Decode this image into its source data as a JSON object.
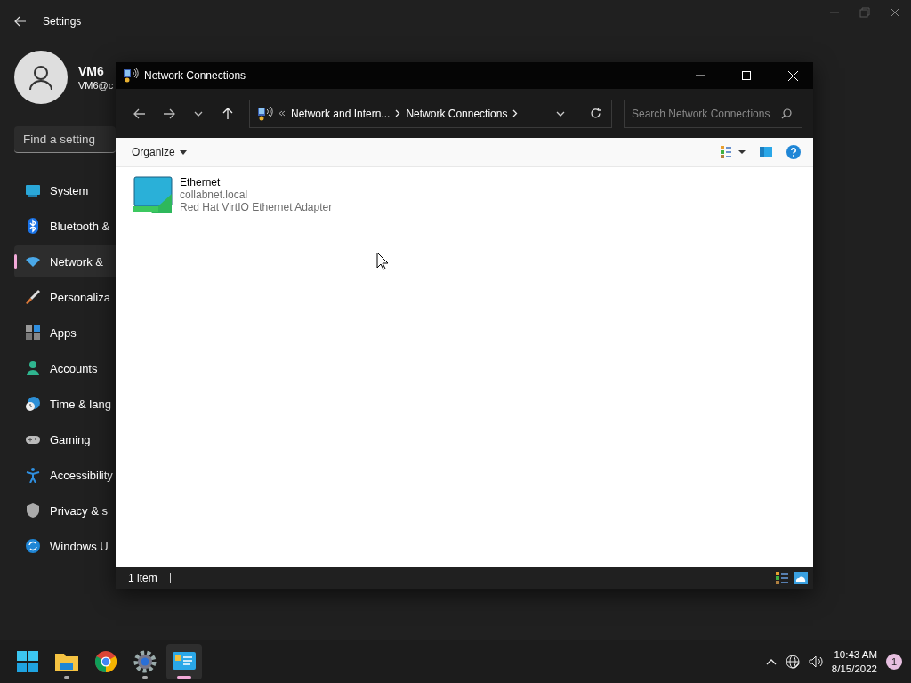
{
  "settings": {
    "title": "Settings",
    "user": {
      "name": "VM6",
      "email": "VM6@c"
    },
    "search": {
      "placeholder": "Find a setting"
    },
    "nav": [
      {
        "kind": "system",
        "label": "System",
        "selected": false
      },
      {
        "kind": "bluetooth",
        "label": "Bluetooth &",
        "selected": false
      },
      {
        "kind": "network",
        "label": "Network &",
        "selected": true
      },
      {
        "kind": "personalization",
        "label": "Personaliza",
        "selected": false
      },
      {
        "kind": "apps",
        "label": "Apps",
        "selected": false
      },
      {
        "kind": "accounts",
        "label": "Accounts",
        "selected": false
      },
      {
        "kind": "time",
        "label": "Time & lang",
        "selected": false
      },
      {
        "kind": "gaming",
        "label": "Gaming",
        "selected": false
      },
      {
        "kind": "accessibility",
        "label": "Accessibility",
        "selected": false
      },
      {
        "kind": "privacy",
        "label": "Privacy & s",
        "selected": false
      },
      {
        "kind": "update",
        "label": "Windows U",
        "selected": false
      }
    ]
  },
  "explorer": {
    "title": "Network Connections",
    "breadcrumb": [
      "Network and Intern...",
      "Network Connections"
    ],
    "search": {
      "placeholder": "Search Network Connections"
    },
    "organize": "Organize",
    "items": [
      {
        "name": "Ethernet",
        "lines": [
          "collabnet.local",
          "Red Hat VirtIO Ethernet Adapter"
        ]
      }
    ],
    "status": "1 item"
  },
  "taskbar": {
    "apps": [
      {
        "kind": "start",
        "running": false,
        "selected": false
      },
      {
        "kind": "files",
        "running": true,
        "selected": false
      },
      {
        "kind": "chrome",
        "running": false,
        "selected": false
      },
      {
        "kind": "settings",
        "running": true,
        "selected": false
      },
      {
        "kind": "network",
        "running": true,
        "selected": true
      }
    ],
    "time": "10:43 AM",
    "date": "8/15/2022",
    "badge": "1"
  }
}
